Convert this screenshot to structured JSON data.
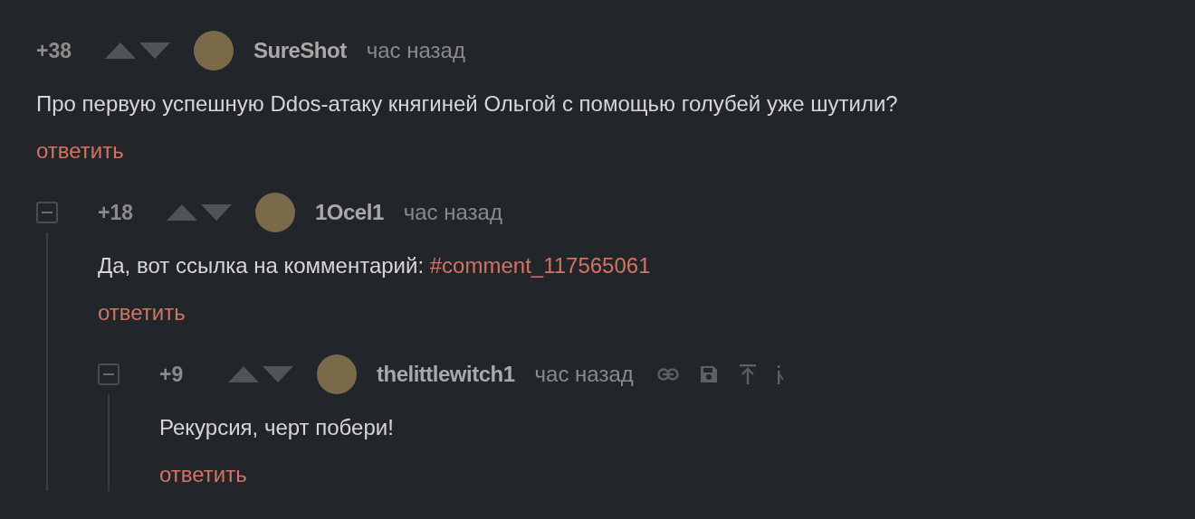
{
  "comments": [
    {
      "rating": "+38",
      "author": "SureShot",
      "time": "час назад",
      "collapsible": false,
      "show_actions": false,
      "body": [
        {
          "kind": "text",
          "text": "Про первую успешную Ddos-атаку княгиней Ольгой с помощью голубей уже шутили?"
        }
      ],
      "reply": "ответить",
      "children": [
        {
          "rating": "+18",
          "author": "1Ocel1",
          "time": "час назад",
          "collapsible": true,
          "show_actions": false,
          "body": [
            {
              "kind": "text",
              "text": "Да, вот ссылка на комментарий: "
            },
            {
              "kind": "link",
              "text": "#comment_117565061"
            }
          ],
          "reply": "ответить",
          "children": [
            {
              "rating": "+9",
              "author": "thelittlewitch1",
              "time": "час назад",
              "collapsible": true,
              "show_actions": true,
              "body": [
                {
                  "kind": "text",
                  "text": "Рекурсия, черт побери!"
                }
              ],
              "reply": "ответить"
            }
          ]
        }
      ]
    }
  ]
}
